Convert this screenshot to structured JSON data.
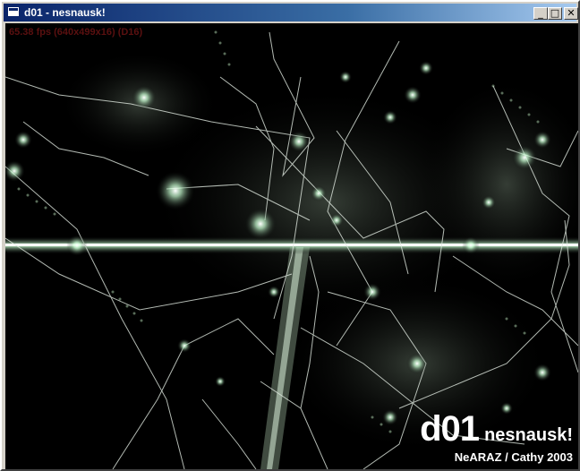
{
  "window": {
    "title": "d01 - nesnausk!",
    "min_label": "_",
    "max_label": "□",
    "close_label": "✕"
  },
  "overlay": {
    "fps_text": "65.38 fps (640x499x16) (D16)",
    "title_big": "d01",
    "title_small": "nesnausk!",
    "credits": "NeARAZ / Cathy 2003"
  },
  "colors": {
    "titlebar_start": "#0a246a",
    "glow": "#c8ffd2",
    "line": "#dfe8df"
  }
}
